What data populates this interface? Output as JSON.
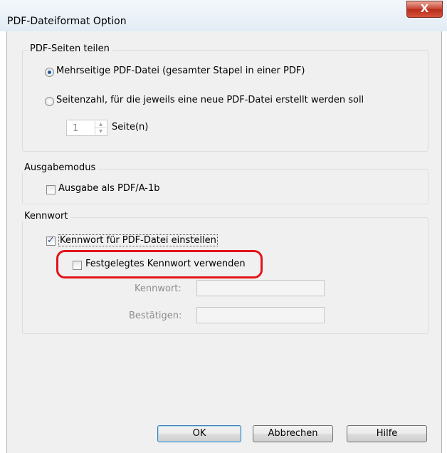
{
  "window": {
    "title": "PDF-Dateiformat Option",
    "close_glyph": "X"
  },
  "split": {
    "legend": "PDF-Seiten teilen",
    "option_multi": "Mehrseitige PDF-Datei (gesamter Stapel in einer PDF)",
    "option_multi_selected": true,
    "option_pages": "Seitenzahl, für die jeweils eine neue PDF-Datei erstellt werden soll",
    "option_pages_selected": false,
    "pages_value": "1",
    "pages_unit": "Seite(n)"
  },
  "output": {
    "legend": "Ausgabemodus",
    "pdfa_label": "Ausgabe als PDF/A-1b",
    "pdfa_checked": false
  },
  "password": {
    "legend": "Kennwort",
    "set_label": "Kennwort für PDF-Datei einstellen",
    "set_checked": true,
    "fixed_label": "Festgelegtes Kennwort verwenden",
    "fixed_checked": false,
    "password_label": "Kennwort:",
    "confirm_label": "Bestätigen:",
    "password_value": "",
    "confirm_value": ""
  },
  "buttons": {
    "ok": "OK",
    "cancel": "Abbrechen",
    "help": "Hilfe"
  },
  "colors": {
    "highlight": "#e3141b",
    "close_button": "#c7402f"
  }
}
